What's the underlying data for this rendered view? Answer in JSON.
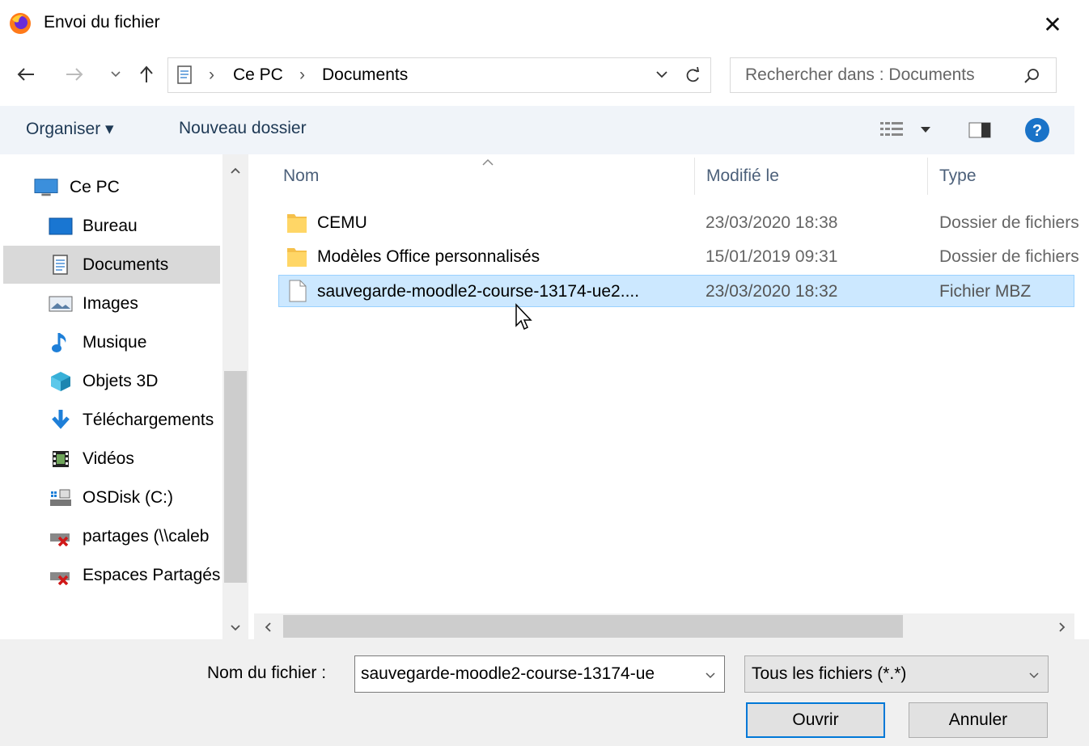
{
  "window": {
    "title": "Envoi du fichier",
    "close_glyph": "✕"
  },
  "address": {
    "breadcrumb": [
      "Ce PC",
      "Documents"
    ],
    "separator": "›"
  },
  "search": {
    "placeholder": "Rechercher dans : Documents"
  },
  "toolbar": {
    "organize_label": "Organiser ▾",
    "new_folder_label": "Nouveau dossier"
  },
  "sidebar": {
    "items": [
      {
        "label": "Ce PC",
        "icon": "computer-icon"
      },
      {
        "label": "Bureau",
        "icon": "desktop-icon"
      },
      {
        "label": "Documents",
        "icon": "documents-icon",
        "selected": true
      },
      {
        "label": "Images",
        "icon": "images-icon"
      },
      {
        "label": "Musique",
        "icon": "music-icon"
      },
      {
        "label": "Objets 3D",
        "icon": "3d-objects-icon"
      },
      {
        "label": "Téléchargements",
        "icon": "downloads-icon"
      },
      {
        "label": "Vidéos",
        "icon": "videos-icon"
      },
      {
        "label": "OSDisk (C:)",
        "icon": "drive-icon"
      },
      {
        "label": "partages (\\\\caleb",
        "icon": "network-drive-disconnected-icon"
      },
      {
        "label": "Espaces Partagés",
        "icon": "network-drive-disconnected-icon"
      }
    ]
  },
  "filelist": {
    "columns": [
      "Nom",
      "Modifié le",
      "Type"
    ],
    "rows": [
      {
        "name": "CEMU",
        "modified": "23/03/2020 18:38",
        "type": "Dossier de fichiers",
        "icon": "folder-icon"
      },
      {
        "name": "Modèles Office personnalisés",
        "modified": "15/01/2019 09:31",
        "type": "Dossier de fichiers",
        "icon": "folder-icon"
      },
      {
        "name": "sauvegarde-moodle2-course-13174-ue2....",
        "modified": "23/03/2020 18:32",
        "type": "Fichier MBZ",
        "icon": "file-icon",
        "selected": true
      }
    ]
  },
  "bottom": {
    "filename_label": "Nom du fichier :",
    "filename_value": "sauvegarde-moodle2-course-13174-ue",
    "filter_value": "Tous les fichiers (*.*)",
    "open_label": "Ouvrir",
    "cancel_label": "Annuler"
  },
  "colors": {
    "accent": "#0078d7",
    "selection": "#cce8ff",
    "toolbar_bg": "#f0f4f9",
    "help": "#1a73c8"
  }
}
